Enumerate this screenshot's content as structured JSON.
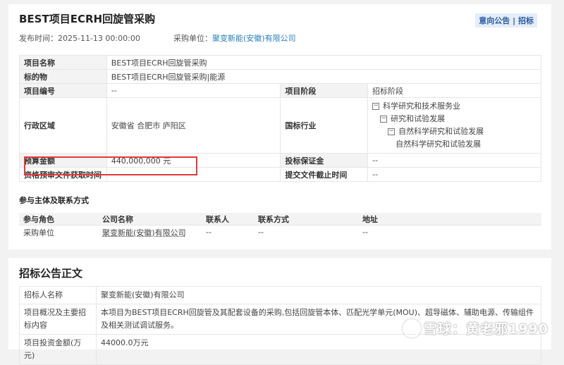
{
  "header": {
    "title": "BEST项目ECRH回旋管采购",
    "tag_intent": "意向公告",
    "tag_sep": "|",
    "tag_bid": "招标",
    "publish_label": "发布时间：",
    "publish_time": "2025-11-13 00:00:00",
    "buyer_label": "采购单位：",
    "buyer_name": "聚变新能(安徽)有限公司"
  },
  "info": {
    "project_name_label": "项目名称",
    "project_name": "BEST项目ECRH回旋管采购",
    "subject_label": "标的物",
    "subject": "BEST项目ECRH回旋管采购|能源",
    "project_no_label": "项目编号",
    "project_no": "--",
    "stage_label": "项目阶段",
    "stage": "招标阶段",
    "region_label": "行政区域",
    "region": "安徽省 合肥市 庐阳区",
    "industry_label": "国标行业",
    "industry_tree": [
      "科学研究和技术服务业",
      "研究和试验发展",
      "自然科学研究和试验发展",
      "自然科学研究和试验发展"
    ],
    "tree_collapse_symbol": "−",
    "budget_label": "预算金额",
    "budget": "440,000,000 元",
    "deposit_label": "投标保证金",
    "deposit": "--",
    "prequal_time_label": "资格预审文件获取时间",
    "prequal_time": "--",
    "submit_deadline_label": "提交文件截止时间",
    "submit_deadline": "--"
  },
  "parties": {
    "section_title": "参与主体及联系方式",
    "columns": [
      "参与角色",
      "公司名称",
      "联系人",
      "联系方式",
      "地址"
    ],
    "rows": [
      [
        "采购单位",
        "聚变新能(安徽)有限公司",
        "--",
        "--",
        "--"
      ]
    ]
  },
  "notice": {
    "title": "招标公告正文",
    "rows": [
      {
        "k": "招标人名称",
        "v": "聚变新能(安徽)有限公司"
      },
      {
        "k": "项目概况及主要招标内容",
        "v": "本项目为BEST项目ECRH回旋管及其配套设备的采购,包括回旋管本体、匹配光学单元(MOU)、超导磁体、辅助电源、传输组件及相关测试调试服务。"
      },
      {
        "k": "项目投资金额(万元)",
        "v": "44000.0万元"
      }
    ]
  },
  "watermark": {
    "text": "雪球：黄老邪1990"
  },
  "colors": {
    "accent_link": "#2a7fbf",
    "highlight_box": "#e03a3a",
    "tag_bg": "#e4edf8"
  }
}
